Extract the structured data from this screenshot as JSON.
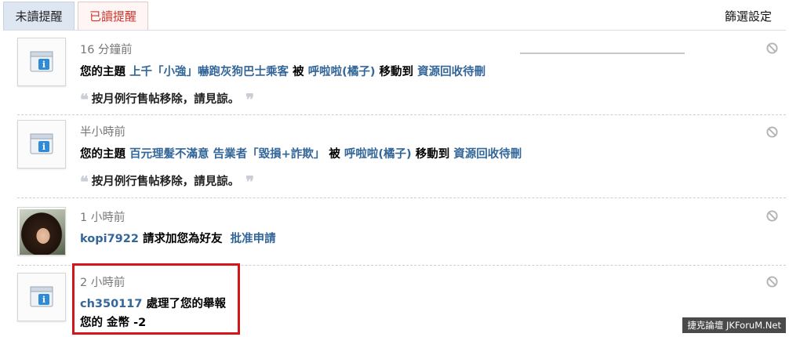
{
  "tabs": {
    "unread": "未讀提醒",
    "read": "已讀提醒"
  },
  "filter_label": "篩選設定",
  "notifications": [
    {
      "time": "16 分鐘前",
      "prefix": "您的主題",
      "topic": "上千「小強」嚇跑灰狗巴士乘客",
      "by": "被",
      "user": "呼啦啦(橘子)",
      "action": "移動到",
      "target": "資源回收待刪",
      "quote": "按月例行售帖移除，請見諒。"
    },
    {
      "time": "半小時前",
      "prefix": "您的主題",
      "topic": "百元理髮不滿意 告業者「毀損+詐欺」",
      "by": "被",
      "user": "呼啦啦(橘子)",
      "action": "移動到",
      "target": "資源回收待刪",
      "quote": "按月例行售帖移除，請見諒。"
    },
    {
      "time": "1 小時前",
      "user": "kopi7922",
      "text": "請求加您為好友",
      "link": "批准申請"
    },
    {
      "time": "2 小時前",
      "user": "ch350117",
      "text": "處理了您的舉報",
      "line2": "您的 金幣 -2"
    }
  ],
  "quote_open": "❝",
  "quote_close": "❞",
  "watermark": "捷克論壇 JKForuM.Net",
  "colors": {
    "link": "#336699",
    "highlight": "#d4161b",
    "read_tab_text": "#d0352c"
  },
  "icons": [
    "system-notice-icon",
    "delete-icon",
    "user-avatar"
  ]
}
